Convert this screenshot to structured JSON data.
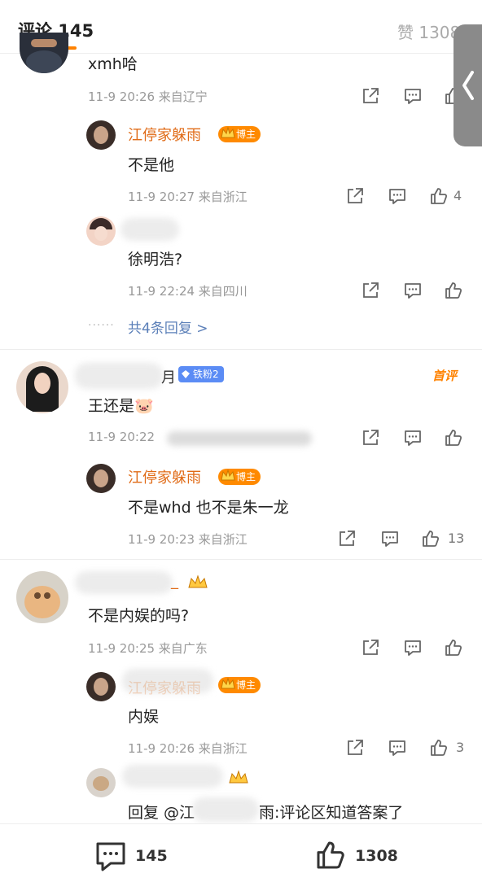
{
  "header": {
    "comments_tab": "评论 145",
    "likes_tab": "赞 1308"
  },
  "comments": [
    {
      "text": "xmh哈",
      "meta": "11-9 20:26 来自辽宁",
      "replies": [
        {
          "name": "江停家躲雨",
          "badge": "博主",
          "text": "不是他",
          "meta": "11-9 20:27 来自浙江",
          "likes": "4"
        },
        {
          "name": "",
          "text": "徐明浩?",
          "meta": "11-9 22:24 来自四川",
          "likes": ""
        }
      ],
      "more_replies": "共4条回复 >"
    },
    {
      "name_suffix": "月",
      "fan_badge": "铁粉2",
      "tag": "首评",
      "text": "王还是🐷",
      "meta": "11-9 20:22",
      "replies": [
        {
          "name": "江停家躲雨",
          "badge": "博主",
          "text": "不是whd 也不是朱一龙",
          "meta": "11-9 20:23 来自浙江",
          "likes": "13"
        }
      ]
    },
    {
      "name_suffix": "_",
      "text": "不是内娱的吗?",
      "meta": "11-9 20:25 来自广东",
      "replies": [
        {
          "name": "江停家躲雨",
          "badge": "博主",
          "text": "内娱",
          "meta": "11-9 20:26 来自浙江",
          "likes": "3"
        },
        {
          "text_prefix": "回复 @江",
          "text_suffix": "雨:评论区知道答案了"
        }
      ]
    }
  ],
  "bottom_bar": {
    "comment_count": "145",
    "like_count": "1308"
  },
  "colors": {
    "accent": "#ff8200",
    "username": "#e06b17",
    "link": "#5b7fb8"
  }
}
